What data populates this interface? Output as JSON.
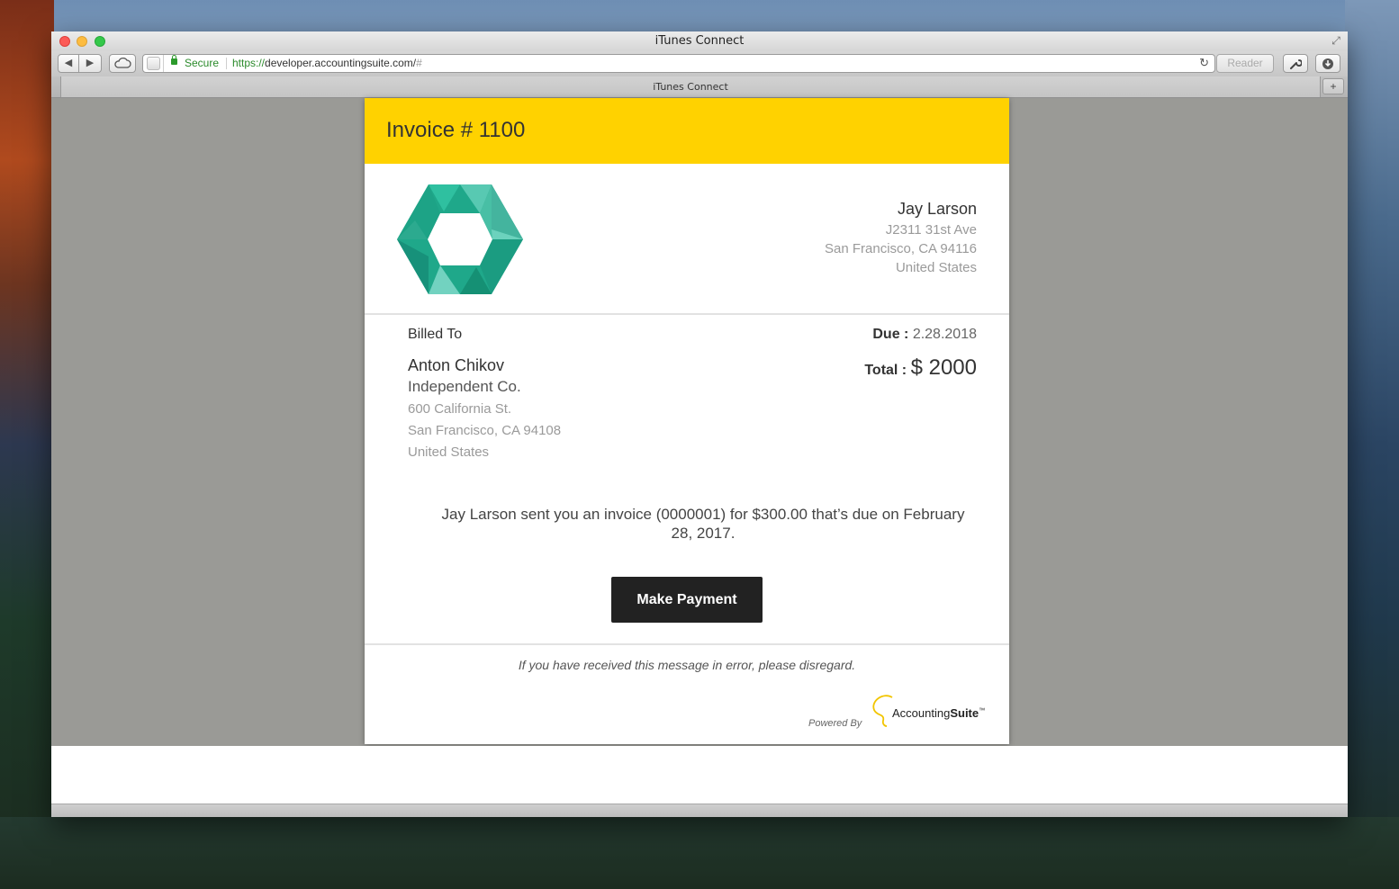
{
  "window": {
    "title": "iTunes Connect",
    "tab_title": "iTunes Connect"
  },
  "toolbar": {
    "back_icon": "◀",
    "forward_icon": "▶",
    "secure_label": "Secure",
    "url_scheme": "https://",
    "url_host": "developer.accountingsuite.com/",
    "url_hash": "#",
    "reader_label": "Reader",
    "newtab_icon": "+"
  },
  "invoice": {
    "title": "Invoice # 1100",
    "accent_color": "#ffd200",
    "from": {
      "name": "Jay Larson",
      "address1": "J2311 31st Ave",
      "city_line": "San Francisco, CA 94116",
      "country": "United States"
    },
    "billed_to": {
      "label": "Billed To",
      "name": "Anton Chikov",
      "company": "Independent Co.",
      "address1": "600 California St.",
      "city_line": "San Francisco,  CA 94108",
      "country": "United States"
    },
    "due": {
      "label": "Due :",
      "value": "2.28.2018"
    },
    "total": {
      "label": "Total :",
      "value": "$ 2000"
    },
    "message": "Jay Larson sent you an invoice (0000001) for $300.00 that’s due on February 28, 2017.",
    "pay_button": "Make Payment",
    "error_note": "If you have received this message in error, please disregard.",
    "powered_by": "Powered By",
    "brand_prefix": "Accounting",
    "brand_suffix": "Suite",
    "brand_tm": "™"
  }
}
